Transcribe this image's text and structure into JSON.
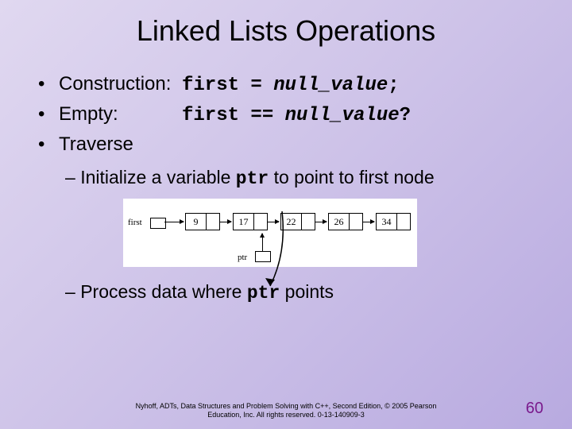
{
  "title": "Linked Lists Operations",
  "bullets": {
    "construction": {
      "label": "Construction:",
      "code_lhs": "first = ",
      "code_rhs": "null_value",
      "code_tail": ";"
    },
    "empty": {
      "label": "Empty:",
      "code_lhs": "first == ",
      "code_rhs": "null_value",
      "code_tail": "?"
    },
    "traverse": {
      "label": "Traverse"
    }
  },
  "sub1": {
    "dash": "– ",
    "t1": "Initialize a variable ",
    "code": "ptr",
    "t2": " to point to first node"
  },
  "sub2": {
    "dash": "– ",
    "t1": "Process data where ",
    "code": "ptr",
    "t2": " points"
  },
  "diagram": {
    "first_label": "first",
    "ptr_label": "ptr",
    "nodes": [
      "9",
      "17",
      "22",
      "26",
      "34"
    ]
  },
  "footer": {
    "line1": "Nyhoff, ADTs, Data Structures and Problem Solving with C++, Second Edition, © 2005 Pearson",
    "line2": "Education, Inc. All rights reserved. 0-13-140909-3"
  },
  "page": "60"
}
